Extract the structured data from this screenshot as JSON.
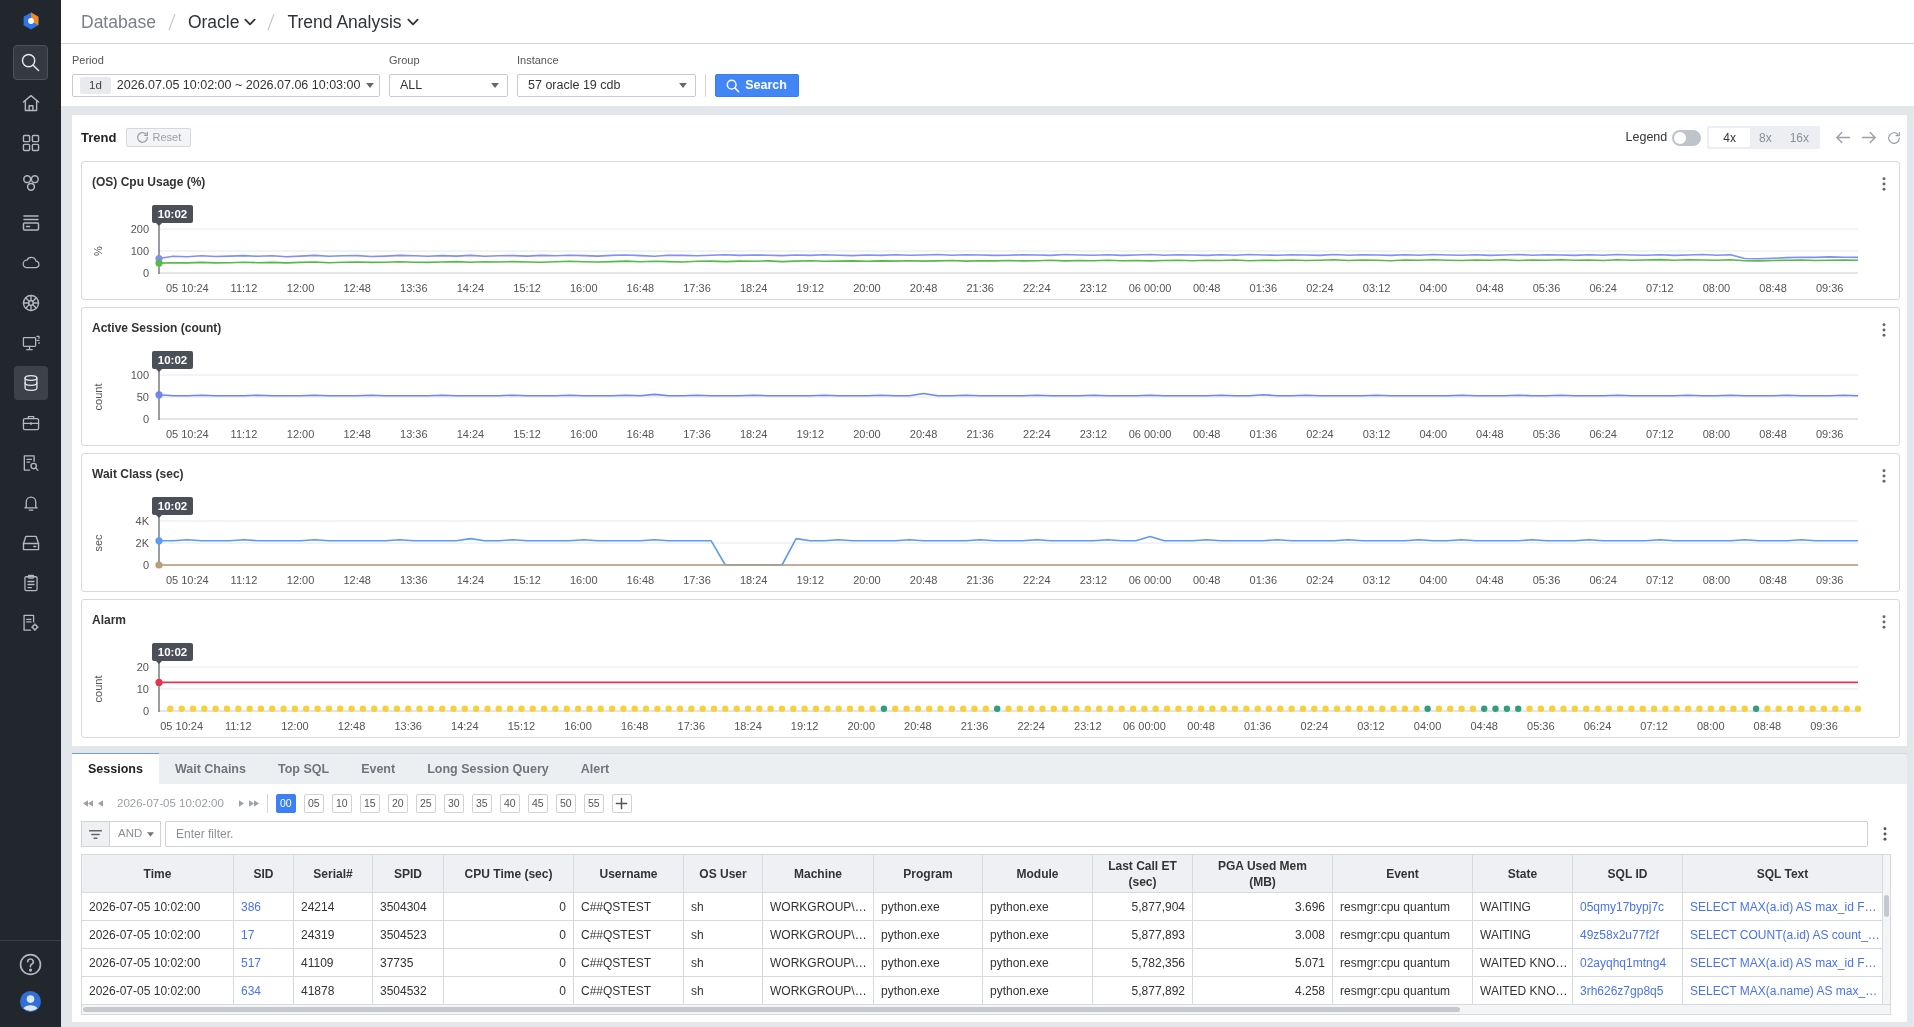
{
  "sidebar": {
    "nav": [
      {
        "selected": false
      },
      {
        "selected": false
      },
      {
        "selected": false
      },
      {
        "selected": false
      },
      {
        "selected": false
      },
      {
        "selected": false
      },
      {
        "selected": false
      },
      {
        "selected": true
      },
      {
        "selected": false
      },
      {
        "selected": false
      },
      {
        "selected": false
      },
      {
        "selected": false
      },
      {
        "selected": false
      },
      {
        "selected": false
      }
    ]
  },
  "breadcrumb": [
    {
      "label": "Database",
      "dropdown": false
    },
    {
      "label": "Oracle",
      "dropdown": true
    },
    {
      "label": "Trend Analysis",
      "dropdown": true
    }
  ],
  "filters": [
    {
      "label": "Period",
      "badge": "1d",
      "value": "2026.07.05 10:02:00 ~ 2026.07.06 10:03:00"
    },
    {
      "label": "Group",
      "value": "ALL"
    },
    {
      "label": "Instance",
      "value": "57 oracle 19 cdb"
    }
  ],
  "search_button": {
    "label": "Search"
  },
  "trend": {
    "title": "Trend",
    "reset": {
      "label": "Reset",
      "disabled": true
    },
    "legend": {
      "label": "Legend",
      "on": false
    },
    "zoom_options": [
      {
        "label": "4x",
        "selected": true
      },
      {
        "label": "8x",
        "selected": false
      },
      {
        "label": "16x",
        "selected": false
      }
    ],
    "charts": [
      {
        "title": "(OS) Cpu Usage (%)",
        "cursor_label": "10:02",
        "chart_data": {
          "type": "line",
          "ylabel": "%",
          "ylim": [
            0,
            200
          ],
          "yticks": [
            0,
            100,
            200
          ],
          "categories": [
            null,
            null,
            "05 10:24",
            null,
            null,
            null,
            "11:12",
            null,
            null,
            null,
            "12:00",
            null,
            null,
            null,
            "12:48",
            null,
            null,
            null,
            "13:36",
            null,
            null,
            null,
            "14:24",
            null,
            null,
            null,
            "15:12",
            null,
            null,
            null,
            "16:00",
            null,
            null,
            null,
            "16:48",
            null,
            null,
            null,
            "17:36",
            null,
            null,
            null,
            "18:24",
            null,
            null,
            null,
            "19:12",
            null,
            null,
            null,
            "20:00",
            null,
            null,
            null,
            "20:48",
            null,
            null,
            null,
            "21:36",
            null,
            null,
            null,
            "22:24",
            null,
            null,
            null,
            "23:12",
            null,
            null,
            null,
            "06 00:00",
            null,
            null,
            null,
            "00:48",
            null,
            null,
            null,
            "01:36",
            null,
            null,
            null,
            "02:24",
            null,
            null,
            null,
            "03:12",
            null,
            null,
            null,
            "04:00",
            null,
            null,
            null,
            "04:48",
            null,
            null,
            null,
            "05:36",
            null,
            null,
            null,
            "06:24",
            null,
            null,
            null,
            "07:12",
            null,
            null,
            null,
            "08:00",
            null,
            null,
            null,
            "08:48",
            null,
            null,
            null,
            "09:36",
            null,
            null
          ],
          "series": [
            {
              "color": "#8190f2",
              "values": [
                66,
                76,
                74,
                78,
                75,
                77,
                79,
                76,
                78,
                74,
                77,
                80,
                76,
                78,
                79,
                75,
                77,
                80,
                78,
                76,
                79,
                77,
                80,
                76,
                78,
                79,
                77,
                80,
                78,
                81,
                79,
                77,
                80,
                82,
                79,
                76,
                81,
                80,
                78,
                81,
                83,
                80,
                82,
                81,
                79,
                82,
                80,
                83,
                81,
                79,
                82,
                80,
                83,
                81,
                82,
                84,
                81,
                83,
                82,
                80,
                81,
                83,
                82,
                80,
                84,
                82,
                81,
                83,
                80,
                82,
                84,
                81,
                83,
                82,
                80,
                83,
                81,
                84,
                82,
                81,
                83,
                82,
                80,
                84,
                81,
                83,
                82,
                80,
                83,
                81,
                84,
                82,
                81,
                83,
                80,
                82,
                84,
                81,
                83,
                82,
                80,
                83,
                81,
                84,
                82,
                81,
                83,
                80,
                82,
                84,
                81,
                83,
                66,
                65,
                67,
                70,
                72,
                71,
                73,
                72,
                71
              ]
            },
            {
              "color": "#57b947",
              "values": [
                45,
                47,
                46,
                48,
                46,
                47,
                49,
                47,
                48,
                46,
                48,
                50,
                47,
                49,
                50,
                48,
                49,
                51,
                49,
                48,
                50,
                52,
                49,
                51,
                50,
                52,
                50,
                49,
                51,
                53,
                51,
                50,
                52,
                54,
                51,
                53,
                52,
                50,
                53,
                54,
                52,
                54,
                53,
                55,
                52,
                54,
                56,
                53,
                54,
                55,
                53,
                55,
                54,
                56,
                54,
                55,
                57,
                54,
                56,
                55,
                57,
                55,
                56,
                58,
                55,
                57,
                56,
                58,
                56,
                57,
                55,
                57,
                58,
                56,
                58,
                57,
                59,
                56,
                58,
                57,
                59,
                57,
                58,
                60,
                57,
                59,
                58,
                56,
                59,
                58,
                60,
                58,
                57,
                59,
                58,
                60,
                57,
                59,
                58,
                60,
                58,
                59,
                57,
                60,
                58,
                59,
                61,
                58,
                60,
                59,
                58,
                60,
                56,
                55,
                57,
                58,
                59,
                57,
                58,
                59,
                58
              ]
            }
          ]
        }
      },
      {
        "title": "Active Session (count)",
        "cursor_label": "10:02",
        "chart_data": {
          "type": "line",
          "ylabel": "count",
          "ylim": [
            0,
            100
          ],
          "yticks": [
            0,
            50,
            100
          ],
          "categories": [
            null,
            null,
            "05 10:24",
            null,
            null,
            null,
            "11:12",
            null,
            null,
            null,
            "12:00",
            null,
            null,
            null,
            "12:48",
            null,
            null,
            null,
            "13:36",
            null,
            null,
            null,
            "14:24",
            null,
            null,
            null,
            "15:12",
            null,
            null,
            null,
            "16:00",
            null,
            null,
            null,
            "16:48",
            null,
            null,
            null,
            "17:36",
            null,
            null,
            null,
            "18:24",
            null,
            null,
            null,
            "19:12",
            null,
            null,
            null,
            "20:00",
            null,
            null,
            null,
            "20:48",
            null,
            null,
            null,
            "21:36",
            null,
            null,
            null,
            "22:24",
            null,
            null,
            null,
            "23:12",
            null,
            null,
            null,
            "06 00:00",
            null,
            null,
            null,
            "00:48",
            null,
            null,
            null,
            "01:36",
            null,
            null,
            null,
            "02:24",
            null,
            null,
            null,
            "03:12",
            null,
            null,
            null,
            "04:00",
            null,
            null,
            null,
            "04:48",
            null,
            null,
            null,
            "05:36",
            null,
            null,
            null,
            "06:24",
            null,
            null,
            null,
            "07:12",
            null,
            null,
            null,
            "08:00",
            null,
            null,
            null,
            "08:48",
            null,
            null,
            null,
            "09:36",
            null,
            null
          ],
          "series": [
            {
              "color": "#6f86f0",
              "values": [
                55,
                53,
                53,
                54,
                53,
                53,
                53,
                54,
                53,
                53,
                53,
                54,
                53,
                53,
                53,
                54,
                53,
                53,
                53,
                53,
                54,
                53,
                53,
                53,
                53,
                54,
                53,
                53,
                53,
                54,
                53,
                53,
                53,
                54,
                53,
                56,
                53,
                53,
                54,
                53,
                53,
                53,
                54,
                53,
                53,
                53,
                53,
                54,
                53,
                53,
                53,
                54,
                53,
                53,
                58,
                53,
                53,
                54,
                53,
                53,
                53,
                53,
                54,
                53,
                53,
                53,
                54,
                53,
                53,
                53,
                54,
                53,
                53,
                53,
                53,
                54,
                53,
                53,
                55,
                53,
                53,
                54,
                53,
                53,
                53,
                53,
                54,
                53,
                53,
                53,
                53,
                53,
                54,
                53,
                53,
                53,
                54,
                53,
                53,
                54,
                53,
                53,
                53,
                54,
                53,
                53,
                53,
                53,
                54,
                53,
                53,
                54,
                53,
                53,
                53,
                54,
                53,
                53,
                53,
                54,
                53
              ]
            }
          ]
        }
      },
      {
        "title": "Wait Class (sec)",
        "cursor_label": "10:02",
        "chart_data": {
          "type": "line",
          "ylabel": "sec",
          "ylim": [
            0,
            4000
          ],
          "yticks": [
            0,
            {
              "value": 2000,
              "label": "2K"
            },
            {
              "value": 4000,
              "label": "4K"
            }
          ],
          "categories": [
            null,
            null,
            "05 10:24",
            null,
            null,
            null,
            "11:12",
            null,
            null,
            null,
            "12:00",
            null,
            null,
            null,
            "12:48",
            null,
            null,
            null,
            "13:36",
            null,
            null,
            null,
            "14:24",
            null,
            null,
            null,
            "15:12",
            null,
            null,
            null,
            "16:00",
            null,
            null,
            null,
            "16:48",
            null,
            null,
            null,
            "17:36",
            null,
            null,
            null,
            "18:24",
            null,
            null,
            null,
            "19:12",
            null,
            null,
            null,
            "20:00",
            null,
            null,
            null,
            "20:48",
            null,
            null,
            null,
            "21:36",
            null,
            null,
            null,
            "22:24",
            null,
            null,
            null,
            "23:12",
            null,
            null,
            null,
            "06 00:00",
            null,
            null,
            null,
            "00:48",
            null,
            null,
            null,
            "01:36",
            null,
            null,
            null,
            "02:24",
            null,
            null,
            null,
            "03:12",
            null,
            null,
            null,
            "04:00",
            null,
            null,
            null,
            "04:48",
            null,
            null,
            null,
            "05:36",
            null,
            null,
            null,
            "06:24",
            null,
            null,
            null,
            "07:12",
            null,
            null,
            null,
            "08:00",
            null,
            null,
            null,
            "08:48",
            null,
            null,
            null,
            "09:36",
            null,
            null
          ],
          "series": [
            {
              "color": "#5b9bf0",
              "values": [
                2200,
                2200,
                2300,
                2200,
                2200,
                2200,
                2300,
                2200,
                2200,
                2200,
                2200,
                2300,
                2200,
                2200,
                2200,
                2200,
                2200,
                2300,
                2200,
                2200,
                2200,
                2200,
                2400,
                2200,
                2200,
                2300,
                2200,
                2200,
                2200,
                2200,
                2300,
                2200,
                2200,
                2200,
                2200,
                2300,
                2200,
                2200,
                2200,
                2200,
                0,
                0,
                0,
                0,
                0,
                2400,
                2200,
                2200,
                2300,
                2200,
                2200,
                2200,
                2200,
                2300,
                2200,
                2200,
                2200,
                2200,
                2300,
                2200,
                2200,
                2200,
                2300,
                2200,
                2200,
                2200,
                2200,
                2300,
                2200,
                2200,
                2600,
                2200,
                2200,
                2200,
                2300,
                2200,
                2200,
                2200,
                2200,
                2300,
                2200,
                2200,
                2200,
                2200,
                2300,
                2200,
                2200,
                2200,
                2200,
                2300,
                2200,
                2200,
                2300,
                2200,
                2200,
                2200,
                2200,
                2300,
                2200,
                2200,
                2200,
                2300,
                2200,
                2200,
                2200,
                2200,
                2300,
                2200,
                2200,
                2200,
                2200,
                2200,
                2300,
                2200,
                2200,
                2200,
                2300,
                2200,
                2200,
                2200,
                2200
              ]
            },
            {
              "color": "#b79f78",
              "values": [
                0,
                0,
                0,
                0,
                0,
                0,
                0,
                0,
                0,
                0,
                0,
                0,
                0,
                0,
                0,
                0,
                0,
                0,
                0,
                0,
                0,
                0,
                0,
                0,
                0,
                0,
                0,
                0,
                0,
                0,
                0,
                0,
                0,
                0,
                0,
                0,
                0,
                0,
                0,
                0,
                0,
                0,
                0,
                0,
                0,
                0,
                0,
                0,
                0,
                0,
                0,
                0,
                0,
                0,
                0,
                0,
                0,
                0,
                0,
                0,
                0,
                0,
                0,
                0,
                0,
                0,
                0,
                0,
                0,
                0,
                0,
                0,
                0,
                0,
                0,
                0,
                0,
                0,
                0,
                0,
                0,
                0,
                0,
                0,
                0,
                0,
                0,
                0,
                0,
                0,
                0,
                0,
                0,
                0,
                0,
                0,
                0,
                0,
                0,
                0,
                0,
                0,
                0,
                0,
                0,
                0,
                0,
                0,
                0,
                0,
                0,
                0,
                0,
                0,
                0,
                0,
                0,
                0,
                0,
                0,
                0
              ]
            }
          ]
        }
      },
      {
        "title": "Alarm",
        "cursor_label": "10:02",
        "chart_data": {
          "type": "scatter",
          "ylabel": "count",
          "ylim": [
            0,
            20
          ],
          "yticks": [
            0,
            10,
            20
          ],
          "categories": [
            null,
            null,
            "05 10:24",
            null,
            null,
            null,
            null,
            "11:12",
            null,
            null,
            null,
            null,
            "12:00",
            null,
            null,
            null,
            null,
            "12:48",
            null,
            null,
            null,
            null,
            "13:36",
            null,
            null,
            null,
            null,
            "14:24",
            null,
            null,
            null,
            null,
            "15:12",
            null,
            null,
            null,
            null,
            "16:00",
            null,
            null,
            null,
            null,
            "16:48",
            null,
            null,
            null,
            null,
            "17:36",
            null,
            null,
            null,
            null,
            "18:24",
            null,
            null,
            null,
            null,
            "19:12",
            null,
            null,
            null,
            null,
            "20:00",
            null,
            null,
            null,
            null,
            "20:48",
            null,
            null,
            null,
            null,
            "21:36",
            null,
            null,
            null,
            null,
            "22:24",
            null,
            null,
            null,
            null,
            "23:12",
            null,
            null,
            null,
            null,
            "06 00:00",
            null,
            null,
            null,
            null,
            "00:48",
            null,
            null,
            null,
            null,
            "01:36",
            null,
            null,
            null,
            null,
            "02:24",
            null,
            null,
            null,
            null,
            "03:12",
            null,
            null,
            null,
            null,
            "04:00",
            null,
            null,
            null,
            null,
            "04:48",
            null,
            null,
            null,
            null,
            "05:36",
            null,
            null,
            null,
            null,
            "06:24",
            null,
            null,
            null,
            null,
            "07:12",
            null,
            null,
            null,
            null,
            "08:00",
            null,
            null,
            null,
            null,
            "08:48",
            null,
            null,
            null,
            null,
            "09:36",
            null,
            null,
            null
          ],
          "ref_lines": [
            {
              "axis": "y",
              "value": 13,
              "color": "#e5344b"
            }
          ],
          "series": [
            {
              "color": "#f6d13c",
              "values": [
                null,
                1,
                1,
                1,
                1,
                1,
                1,
                1,
                1,
                1,
                1,
                1,
                1,
                1,
                1,
                1,
                1,
                1,
                1,
                1,
                1,
                1,
                1,
                1,
                1,
                1,
                1,
                1,
                1,
                1,
                1,
                1,
                1,
                1,
                1,
                1,
                1,
                1,
                1,
                1,
                1,
                1,
                1,
                1,
                1,
                1,
                1,
                1,
                1,
                1,
                1,
                1,
                1,
                1,
                1,
                1,
                1,
                1,
                1,
                1,
                1,
                1,
                1,
                1,
                null,
                1,
                1,
                1,
                1,
                1,
                1,
                1,
                1,
                1,
                null,
                1,
                1,
                1,
                1,
                1,
                1,
                1,
                1,
                1,
                1,
                1,
                1,
                1,
                1,
                1,
                1,
                1,
                1,
                1,
                1,
                1,
                1,
                1,
                1,
                1,
                1,
                1,
                1,
                1,
                1,
                1,
                1,
                1,
                1,
                1,
                1,
                1,
                null,
                1,
                1,
                1,
                1,
                null,
                null,
                null,
                null,
                1,
                1,
                1,
                1,
                1,
                1,
                1,
                1,
                1,
                1,
                1,
                1,
                1,
                1,
                1,
                1,
                1,
                1,
                1,
                1,
                null,
                1,
                1,
                1,
                1,
                1,
                1,
                1,
                1,
                1
              ]
            },
            {
              "color": "#2f9e7c",
              "values": [
                null,
                null,
                null,
                null,
                null,
                null,
                null,
                null,
                null,
                null,
                null,
                null,
                null,
                null,
                null,
                null,
                null,
                null,
                null,
                null,
                null,
                null,
                null,
                null,
                null,
                null,
                null,
                null,
                null,
                null,
                null,
                null,
                null,
                null,
                null,
                null,
                null,
                null,
                null,
                null,
                null,
                null,
                null,
                null,
                null,
                null,
                null,
                null,
                null,
                null,
                null,
                null,
                null,
                null,
                null,
                null,
                null,
                null,
                null,
                null,
                null,
                null,
                null,
                null,
                1,
                null,
                null,
                null,
                null,
                null,
                null,
                null,
                null,
                null,
                1,
                null,
                null,
                null,
                null,
                null,
                null,
                null,
                null,
                null,
                null,
                null,
                null,
                null,
                null,
                null,
                null,
                null,
                null,
                null,
                null,
                null,
                null,
                null,
                null,
                null,
                null,
                null,
                null,
                null,
                null,
                null,
                null,
                null,
                null,
                null,
                null,
                null,
                1,
                null,
                null,
                null,
                null,
                1,
                1,
                1,
                1,
                null,
                null,
                null,
                null,
                null,
                null,
                null,
                null,
                null,
                null,
                null,
                null,
                null,
                null,
                null,
                null,
                null,
                null,
                null,
                null,
                1,
                null,
                null,
                null,
                null,
                null,
                null,
                null,
                null,
                null
              ]
            }
          ]
        }
      }
    ]
  },
  "bottom_tabs": [
    {
      "label": "Sessions",
      "selected": true
    },
    {
      "label": "Wait Chains",
      "selected": false
    },
    {
      "label": "Top SQL",
      "selected": false
    },
    {
      "label": "Event",
      "selected": false
    },
    {
      "label": "Long Session Query",
      "selected": false
    },
    {
      "label": "Alert",
      "selected": false
    }
  ],
  "time_nav": {
    "time": "2026-07-05 10:02:00",
    "minutes": [
      {
        "label": "00",
        "selected": true
      },
      {
        "label": "05",
        "selected": false
      },
      {
        "label": "10",
        "selected": false
      },
      {
        "label": "15",
        "selected": false
      },
      {
        "label": "20",
        "selected": false
      },
      {
        "label": "25",
        "selected": false
      },
      {
        "label": "30",
        "selected": false
      },
      {
        "label": "35",
        "selected": false
      },
      {
        "label": "40",
        "selected": false
      },
      {
        "label": "45",
        "selected": false
      },
      {
        "label": "50",
        "selected": false
      },
      {
        "label": "55",
        "selected": false
      }
    ]
  },
  "filter_row": {
    "operator": "AND",
    "placeholder": "Enter filter."
  },
  "table": {
    "columns": [
      {
        "label": "Time",
        "kind": "text"
      },
      {
        "label": "SID",
        "kind": "link"
      },
      {
        "label": "Serial#",
        "kind": "text"
      },
      {
        "label": "SPID",
        "kind": "text"
      },
      {
        "label": "CPU Time (sec)",
        "kind": "number"
      },
      {
        "label": "Username",
        "kind": "text"
      },
      {
        "label": "OS User",
        "kind": "text"
      },
      {
        "label": "Machine",
        "kind": "text"
      },
      {
        "label": "Program",
        "kind": "text"
      },
      {
        "label": "Module",
        "kind": "text"
      },
      {
        "label": "Last Call ET (sec)",
        "kind": "number"
      },
      {
        "label": "PGA Used Mem (MB)",
        "kind": "number"
      },
      {
        "label": "Event",
        "kind": "text"
      },
      {
        "label": "State",
        "kind": "text"
      },
      {
        "label": "SQL ID",
        "kind": "link"
      },
      {
        "label": "SQL Text",
        "kind": "link"
      }
    ],
    "rows": [
      [
        "2026-07-05 10:02:00",
        "386",
        "24214",
        "3504304",
        "0",
        "C##QSTEST",
        "sh",
        "WORKGROUP\\…",
        "python.exe",
        "python.exe",
        "5,877,904",
        "3.696",
        "resmgr:cpu quantum",
        "WAITING",
        "05qmy17bypj7c",
        "SELECT MAX(a.id) AS max_id F…"
      ],
      [
        "2026-07-05 10:02:00",
        "17",
        "24319",
        "3504523",
        "0",
        "C##QSTEST",
        "sh",
        "WORKGROUP\\…",
        "python.exe",
        "python.exe",
        "5,877,893",
        "3.008",
        "resmgr:cpu quantum",
        "WAITING",
        "49z58x2u77f2f",
        "SELECT COUNT(a.id) AS count_…"
      ],
      [
        "2026-07-05 10:02:00",
        "517",
        "41109",
        "37735",
        "0",
        "C##QSTEST",
        "sh",
        "WORKGROUP\\…",
        "python.exe",
        "python.exe",
        "5,782,356",
        "5.071",
        "resmgr:cpu quantum",
        "WAITED KNO…",
        "02ayqhq1mtng4",
        "SELECT MAX(a.id) AS max_id F…"
      ],
      [
        "2026-07-05 10:02:00",
        "634",
        "41878",
        "3504532",
        "0",
        "C##QSTEST",
        "sh",
        "WORKGROUP\\…",
        "python.exe",
        "python.exe",
        "5,877,892",
        "4.258",
        "resmgr:cpu quantum",
        "WAITED KNO…",
        "3rh626z7gp8q5",
        "SELECT MAX(a.name) AS max_…"
      ]
    ]
  }
}
